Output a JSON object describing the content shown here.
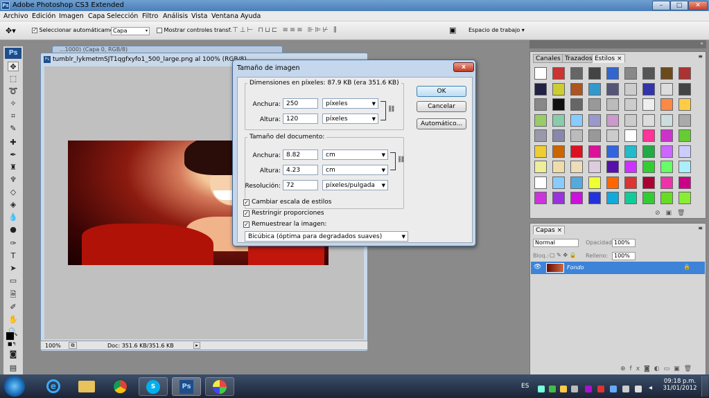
{
  "app": {
    "title": "Adobe Photoshop CS3 Extended",
    "logo": "Ps"
  },
  "menu": [
    "Archivo",
    "Edición",
    "Imagen",
    "Capa",
    "Selección",
    "Filtro",
    "Análisis",
    "Vista",
    "Ventana",
    "Ayuda"
  ],
  "options_bar": {
    "auto_select_label": "Seleccionar automáticamente:",
    "auto_select_value": "Capa",
    "show_transform_label": "Mostrar controles transf.",
    "workspace_label": "Espacio de trabajo"
  },
  "document": {
    "title": "tumblr_lykmetmSJT1qgfxyfo1_500_large.png al 100% (RGB/8)",
    "behind_title": "...1000) (Capa 0, RGB/8)",
    "zoom": "100%",
    "doc_info": "Doc: 351.6 KB/351.6 KB"
  },
  "dialog": {
    "title": "Tamaño de imagen",
    "close": "x",
    "pixel_dims_label": "Dimensiones en píxeles: 87.9 KB (era 351.6 KB)",
    "width_label": "Anchura:",
    "width_value": "250",
    "width_unit": "píxeles",
    "height_label": "Altura:",
    "height_value": "120",
    "height_unit": "píxeles",
    "doc_size_label": "Tamaño del documento:",
    "doc_width_label": "Anchura:",
    "doc_width_value": "8.82",
    "doc_width_unit": "cm",
    "doc_height_label": "Altura:",
    "doc_height_value": "4.23",
    "doc_height_unit": "cm",
    "resolution_label": "Resolución:",
    "resolution_value": "72",
    "resolution_unit": "píxeles/pulgada",
    "scale_styles": "Cambiar escala de estilos",
    "constrain": "Restringir proporciones",
    "resample": "Remuestrear la imagen:",
    "resample_method": "Bicúbica (óptima para degradados suaves)",
    "ok": "OK",
    "cancel": "Cancelar",
    "auto": "Automático..."
  },
  "styles_panel": {
    "tabs": [
      "Canales",
      "Trazados",
      "Estilos"
    ],
    "active_tab": "Estilos"
  },
  "layers_panel": {
    "tab": "Capas",
    "blend_mode": "Normal",
    "opacity_label": "Opacidad:",
    "opacity": "100%",
    "lock_label": "Bloq.:",
    "fill_label": "Relleno:",
    "fill": "100%",
    "layer_name": "Fondo"
  },
  "taskbar": {
    "lang": "ES",
    "time": "09:18 p.m.",
    "date": "31/01/2012"
  },
  "colors": {
    "accent": "#3d83d8",
    "foreground": "#000000",
    "background_swatch": "#d81b1b"
  }
}
